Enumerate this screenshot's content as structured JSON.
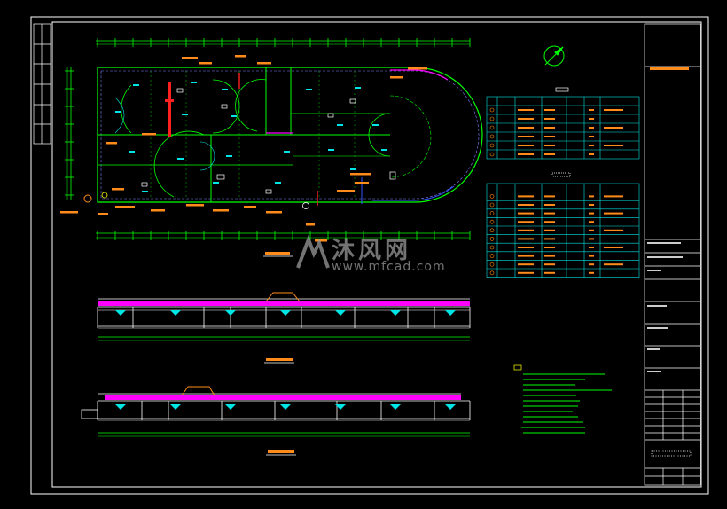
{
  "watermark": {
    "brand_cn": "沐风网",
    "url": "www.mfcad.com"
  },
  "colors": {
    "background": "#000000",
    "frame": "#ffffff",
    "outline": "#00ff00",
    "pipe": "#ff00ff",
    "orange": "#ff8c1a",
    "red": "#ff2020",
    "cyan": "#00e5e5",
    "blue": "#3355ff",
    "yellow": "#ffff00"
  },
  "title_block": {
    "rows": 26
  },
  "legend_table_top": {
    "rows": 7,
    "cols": 7
  },
  "legend_table_bottom": {
    "rows": 11,
    "cols": 7
  },
  "icons": [
    "north-arrow-icon"
  ]
}
